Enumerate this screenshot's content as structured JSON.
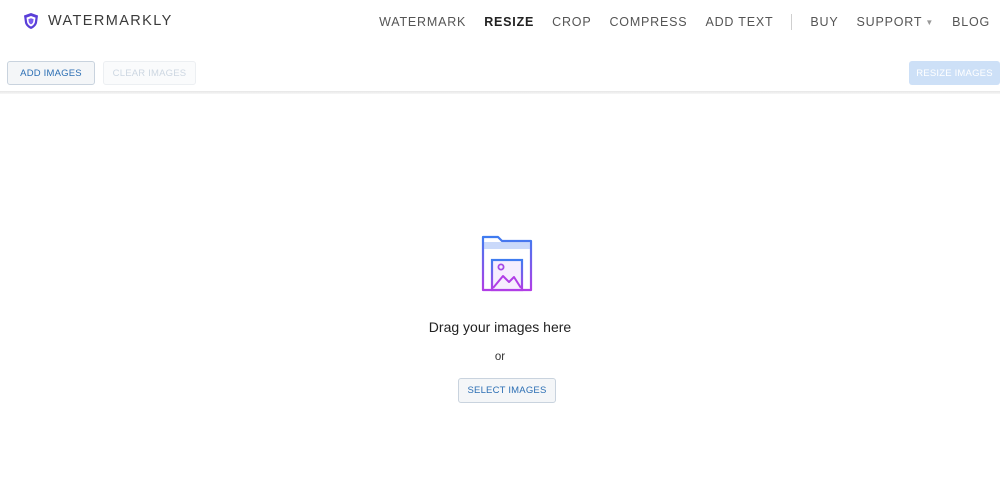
{
  "brand": {
    "name": "WATERMARKLY",
    "icon": "shield-icon",
    "accent": "#6b4ee6"
  },
  "nav": {
    "items": [
      {
        "label": "WATERMARK"
      },
      {
        "label": "RESIZE"
      },
      {
        "label": "CROP"
      },
      {
        "label": "COMPRESS"
      },
      {
        "label": "ADD TEXT"
      },
      {
        "label": "BUY"
      },
      {
        "label": "SUPPORT"
      },
      {
        "label": "BLOG"
      }
    ],
    "active": "RESIZE"
  },
  "toolbar": {
    "add_images": "ADD IMAGES",
    "clear_images": "CLEAR IMAGES",
    "resize_images": "RESIZE IMAGES"
  },
  "dropzone": {
    "icon": "folder-image-icon",
    "title": "Drag your images here",
    "or": "or",
    "select_button": "SELECT IMAGES"
  },
  "colors": {
    "primary_blue": "#2c6fb4",
    "disabled_blue": "#cde0f7",
    "icon_gradient_start": "#3f7cf0",
    "icon_gradient_end": "#b13ee6"
  }
}
